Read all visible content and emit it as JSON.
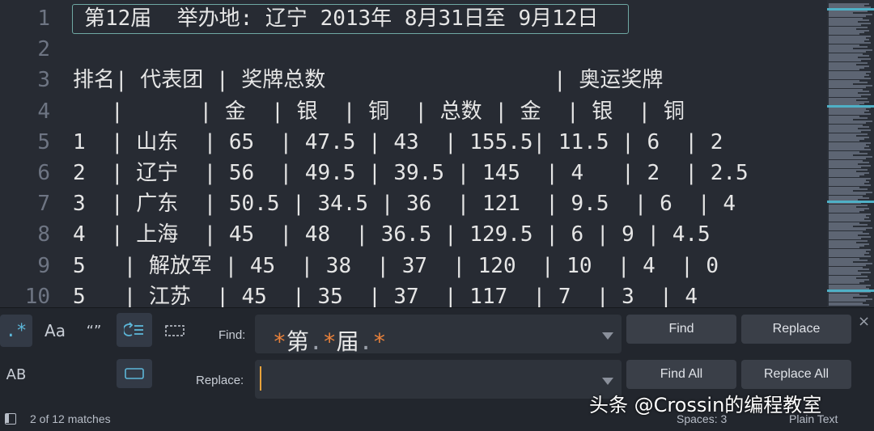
{
  "editor": {
    "line_numbers": [
      "1",
      "2",
      "3",
      "4",
      "5",
      "6",
      "7",
      "8",
      "9",
      "10"
    ],
    "lines": [
      "第12届  举办地: 辽宁 2013年 8月31日至 9月12日",
      "",
      "排名| 代表团 | 奖牌总数                  | 奥运奖牌",
      "   |      | 金  | 银  | 铜  | 总数 | 金  | 银  | 铜",
      "1  | 山东  | 65  | 47.5 | 43  | 155.5| 11.5 | 6  | 2",
      "2  | 辽宁  | 56  | 49.5 | 39.5 | 145  | 4   | 2  | 2.5",
      "3  | 广东  | 50.5 | 34.5 | 36  | 121  | 9.5  | 6  | 4",
      "4  | 上海  | 45  | 48  | 36.5 | 129.5 | 6 | 9 | 4.5",
      "5   | 解放军 | 45  | 38  | 37  | 120  | 10  | 4  | 0",
      "5   | 江苏  | 45  | 35  | 37  | 117  | 7  | 3  | 4"
    ]
  },
  "find_panel": {
    "options": {
      "regex": ".*",
      "case": "Aa",
      "whole_word": "“”",
      "preserve_case": "AB"
    },
    "find_label": "Find:",
    "replace_label": "Replace:",
    "find_value": "*第.*届.*",
    "replace_value": "",
    "buttons": {
      "find": "Find",
      "replace": "Replace",
      "find_all": "Find All",
      "replace_all": "Replace All"
    },
    "close": "×"
  },
  "status_bar": {
    "matches": "2 of 12 matches",
    "spaces": "Spaces: 3",
    "syntax": "Plain Text"
  },
  "watermark": "头条 @Crossin的编程教室",
  "colors": {
    "editor_bg": "#272b33",
    "accent_orange": "#e8813a",
    "match_border": "#6fa8a3",
    "active_option": "#5cb6d8"
  }
}
